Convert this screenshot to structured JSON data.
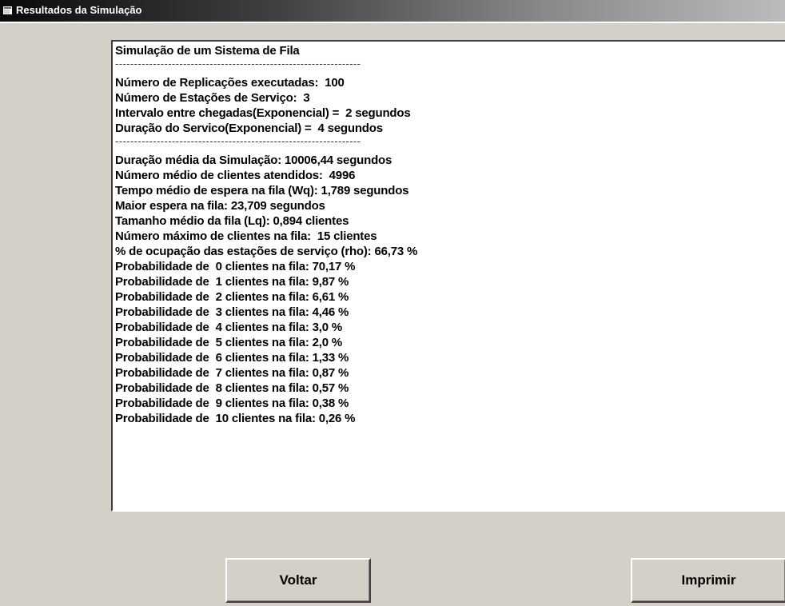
{
  "window": {
    "title": "Resultados da Simulação",
    "icon": "window-app-icon"
  },
  "results": {
    "lines": [
      "Simulação de um Sistema de Fila",
      "-----------------------------------------------------------------",
      "Número de Replicações executadas:  100",
      "Número de Estações de Serviço:  3",
      "Intervalo entre chegadas(Exponencial) =  2 segundos",
      "Duração do Servico(Exponencial) =  4 segundos",
      "-----------------------------------------------------------------",
      "Duração média da Simulação: 10006,44 segundos",
      "Número médio de clientes atendidos:  4996",
      "Tempo médio de espera na fila (Wq): 1,789 segundos",
      "Maior espera na fila: 23,709 segundos",
      "Tamanho médio da fila (Lq): 0,894 clientes",
      "Número máximo de clientes na fila:  15 clientes",
      "% de ocupação das estações de serviço (rho): 66,73 %",
      "Probabilidade de  0 clientes na fila: 70,17 %",
      "Probabilidade de  1 clientes na fila: 9,87 %",
      "Probabilidade de  2 clientes na fila: 6,61 %",
      "Probabilidade de  3 clientes na fila: 4,46 %",
      "Probabilidade de  4 clientes na fila: 3,0 %",
      "Probabilidade de  5 clientes na fila: 2,0 %",
      "Probabilidade de  6 clientes na fila: 1,33 %",
      "Probabilidade de  7 clientes na fila: 0,87 %",
      "Probabilidade de  8 clientes na fila: 0,57 %",
      "Probabilidade de  9 clientes na fila: 0,38 %",
      "Probabilidade de  10 clientes na fila: 0,26 %"
    ]
  },
  "buttons": {
    "voltar_label": "Voltar",
    "imprimir_label": "Imprimir"
  },
  "cursor": {
    "icon": "text-ibeam-cursor-icon"
  },
  "colors": {
    "dialog_background": "#d4d0c8",
    "titlebar_start": "#0a0a0a",
    "titlebar_end": "#bcbcbc",
    "text_area_background": "#ffffff"
  }
}
